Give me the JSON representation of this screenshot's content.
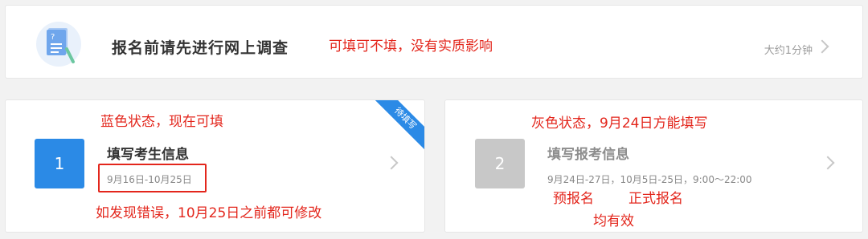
{
  "survey": {
    "title": "报名前请先进行网上调查",
    "note": "可填可不填，没有实质影响",
    "time": "大约1分钟"
  },
  "step1": {
    "number": "1",
    "title": "填写考生信息",
    "dates": "9月16日-10月25日",
    "ribbon": "待填写",
    "note_top": "蓝色状态，现在可填",
    "note_bottom": "如发现错误，10月25日之前都可修改"
  },
  "step2": {
    "number": "2",
    "title": "填写报考信息",
    "dates": "9月24日-27日，10月5日-25日，9:00～22:00",
    "note_top": "灰色状态，9月24日方能填写",
    "note_pre": "预报名",
    "note_formal": "正式报名",
    "note_both": "均有效"
  },
  "colors": {
    "active_blue": "#2b8ae6",
    "inactive_gray": "#c8c8c8",
    "annotation_red": "#e3261c"
  },
  "icons": {
    "survey": "survey-document-icon",
    "chevron": "chevron-right-icon"
  }
}
